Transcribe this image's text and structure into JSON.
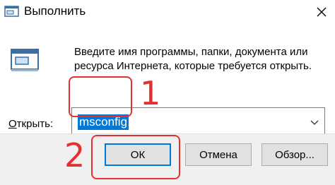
{
  "window": {
    "title": "Выполнить",
    "icon": "run-icon",
    "close_icon": "close-icon"
  },
  "dialog": {
    "description": "Введите имя программы, папки, документа или ресурса Интернета, которые требуется открыть.",
    "open_label_underlined": "О",
    "open_label_rest": "ткрыть:",
    "input_value": "msconfig",
    "dropdown_icon": "chevron-down-icon"
  },
  "buttons": {
    "ok": "ОК",
    "cancel": "Отмена",
    "browse": "Обзор..."
  },
  "annotations": {
    "step1": "1",
    "step2": "2"
  },
  "colors": {
    "accent": "#0078d7",
    "annotation": "#e53030",
    "footer_bg": "#f0f0f0"
  }
}
